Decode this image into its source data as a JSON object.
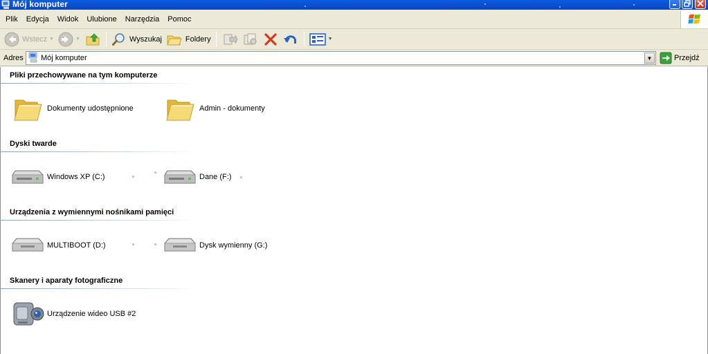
{
  "window": {
    "title": "Mój komputer"
  },
  "menu": {
    "items": [
      "Plik",
      "Edycja",
      "Widok",
      "Ulubione",
      "Narzędzia",
      "Pomoc"
    ]
  },
  "toolbar": {
    "back_label": "Wstecz",
    "search_label": "Wyszukaj",
    "folders_label": "Foldery"
  },
  "address": {
    "label": "Adres",
    "value": "Mój komputer",
    "go_label": "Przejdź"
  },
  "groups": [
    {
      "heading": "Pliki przechowywane na tym komputerze",
      "items": [
        {
          "name": "Dokumenty udostępnione",
          "icon": "folder-icon"
        },
        {
          "name": "Admin - dokumenty",
          "icon": "folder-icon"
        }
      ]
    },
    {
      "heading": "Dyski twarde",
      "items": [
        {
          "name": "Windows XP (C:)",
          "icon": "hard-drive-icon"
        },
        {
          "name": "Dane (F:)",
          "icon": "hard-drive-icon"
        }
      ]
    },
    {
      "heading": "Urządzenia z wymiennymi nośnikami pamięci",
      "items": [
        {
          "name": "MULTIBOOT (D:)",
          "icon": "removable-drive-icon"
        },
        {
          "name": "Dysk wymienny (G:)",
          "icon": "removable-drive-icon"
        }
      ]
    },
    {
      "heading": "Skanery i aparaty fotograficzne",
      "items": [
        {
          "name": "Urządzenie wideo USB #2",
          "icon": "video-camera-icon"
        }
      ]
    }
  ]
}
